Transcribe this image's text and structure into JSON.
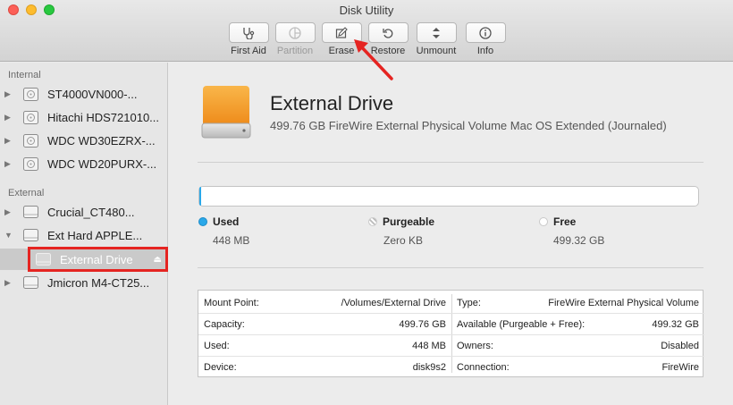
{
  "window": {
    "title": "Disk Utility"
  },
  "toolbar": {
    "first_aid": "First Aid",
    "partition": "Partition",
    "erase": "Erase",
    "restore": "Restore",
    "unmount": "Unmount",
    "info": "Info"
  },
  "sidebar": {
    "internal_header": "Internal",
    "external_header": "External",
    "internal_items": [
      {
        "label": "ST4000VN000-..."
      },
      {
        "label": "Hitachi HDS721010..."
      },
      {
        "label": "WDC WD30EZRX-..."
      },
      {
        "label": "WDC WD20PURX-..."
      }
    ],
    "external_items": [
      {
        "label": "Crucial_CT480..."
      },
      {
        "label": "Ext Hard APPLE..."
      },
      {
        "label": "External Drive"
      },
      {
        "label": "Jmicron M4-CT25..."
      }
    ]
  },
  "drive": {
    "name": "External Drive",
    "description": "499.76 GB FireWire External Physical Volume Mac OS Extended (Journaled)"
  },
  "usage": {
    "used_label": "Used",
    "used_value": "448 MB",
    "purgeable_label": "Purgeable",
    "purgeable_value": "Zero KB",
    "free_label": "Free",
    "free_value": "499.32 GB",
    "colors": {
      "used": "#2aa8e9",
      "free": "#ffffff"
    }
  },
  "info": {
    "left": [
      {
        "key": "Mount Point:",
        "value": "/Volumes/External Drive"
      },
      {
        "key": "Capacity:",
        "value": "499.76 GB"
      },
      {
        "key": "Used:",
        "value": "448 MB"
      },
      {
        "key": "Device:",
        "value": "disk9s2"
      }
    ],
    "right": [
      {
        "key": "Type:",
        "value": "FireWire External Physical Volume"
      },
      {
        "key": "Available (Purgeable + Free):",
        "value": "499.32 GB"
      },
      {
        "key": "Owners:",
        "value": "Disabled"
      },
      {
        "key": "Connection:",
        "value": "FireWire"
      }
    ]
  },
  "annotation": {
    "highlight_color": "#e52421"
  }
}
